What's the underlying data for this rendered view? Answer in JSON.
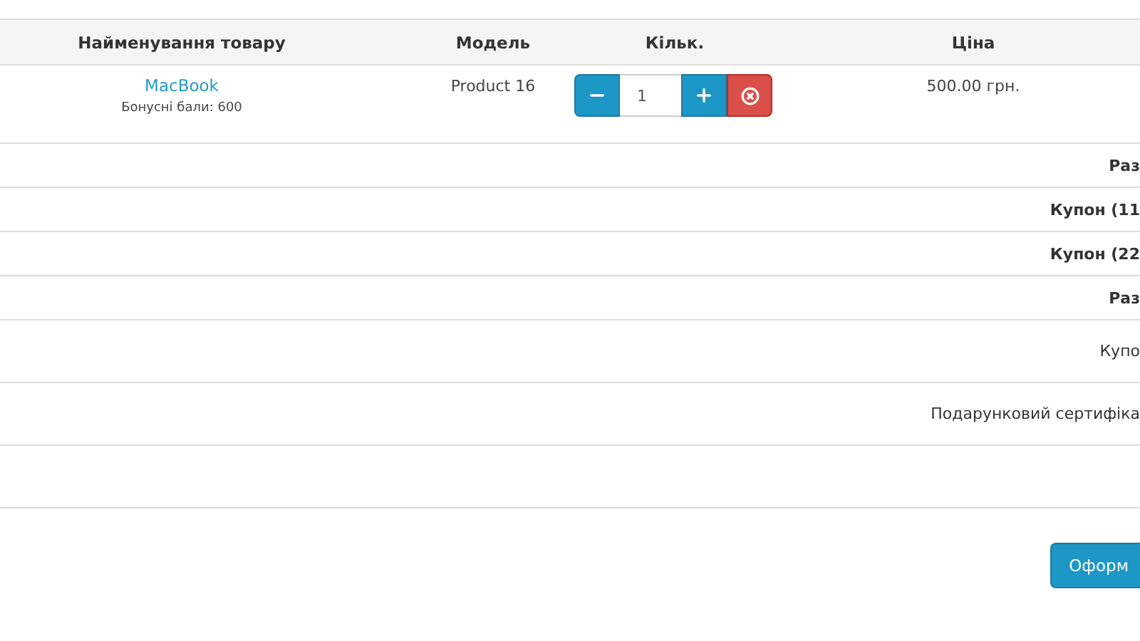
{
  "cart": {
    "columns": [
      "Найменування товару",
      "Модель",
      "Кільк.",
      "Ціна"
    ],
    "rows": [
      {
        "name": "MacBook",
        "bonus": "Бонусні бали: 600",
        "model": "Product 16",
        "quantity": "1",
        "price": "500.00 грн."
      }
    ]
  },
  "totals": [
    {
      "label": "Раз",
      "kind": "total"
    },
    {
      "label": "Купон (11",
      "kind": "total"
    },
    {
      "label": "Купон (22",
      "kind": "total"
    },
    {
      "label": "Раз",
      "kind": "total"
    },
    {
      "label": "Купо",
      "kind": "option"
    },
    {
      "label": "Подарунковий сертифіка",
      "kind": "option"
    }
  ],
  "checkout_button": "Оформ"
}
